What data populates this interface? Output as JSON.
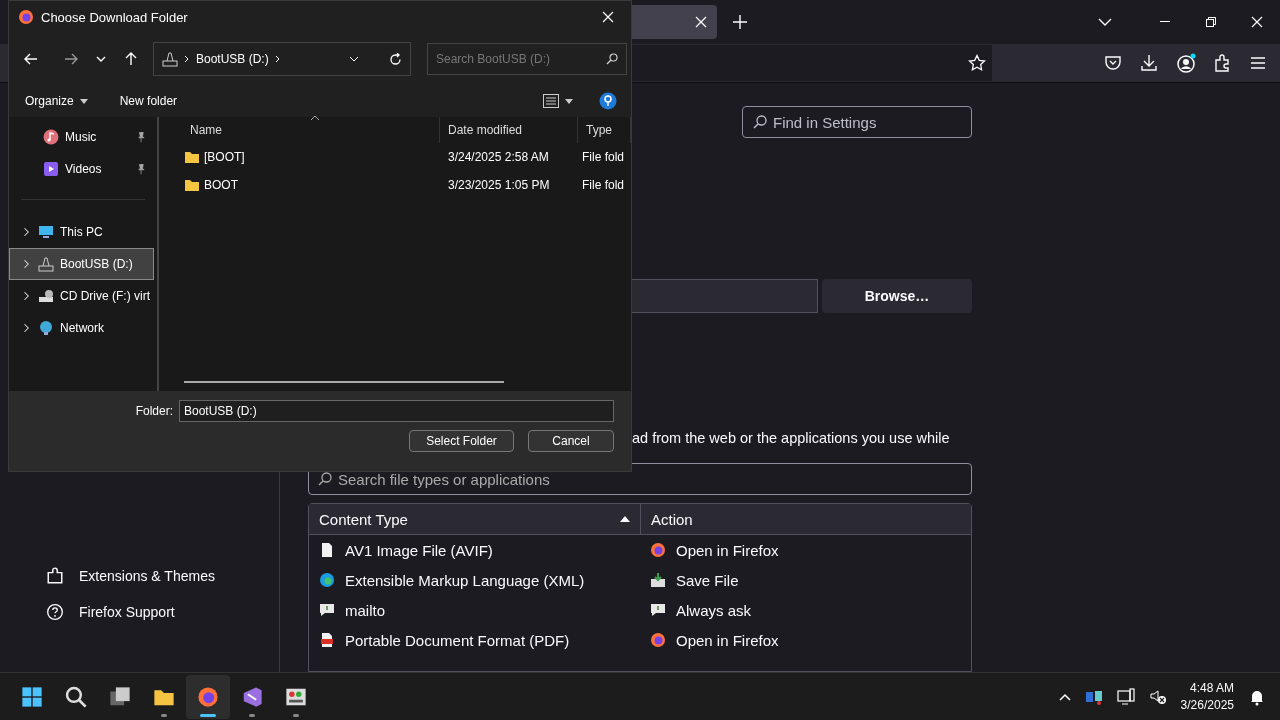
{
  "browser": {
    "find_placeholder": "Find in Settings",
    "browse_button": "Browse…",
    "description": "ad from the web or the applications you use while",
    "sidebar_links": [
      "Extensions & Themes",
      "Firefox Support"
    ],
    "search_placeholder": "Search file types or applications",
    "table": {
      "columns": [
        "Content Type",
        "Action"
      ],
      "rows": [
        {
          "type": "AV1 Image File (AVIF)",
          "action": "Open in Firefox"
        },
        {
          "type": "Extensible Markup Language (XML)",
          "action": "Save File"
        },
        {
          "type": "mailto",
          "action": "Always ask"
        },
        {
          "type": "Portable Document Format (PDF)",
          "action": "Open in Firefox"
        }
      ]
    }
  },
  "dialog": {
    "title": "Choose Download Folder",
    "address": "BootUSB (D:)",
    "search_placeholder": "Search BootUSB (D:)",
    "toolbar": [
      "Organize",
      "New folder"
    ],
    "quick_access": [
      {
        "label": "Music",
        "pinned": true
      },
      {
        "label": "Videos",
        "pinned": true
      }
    ],
    "locations": [
      {
        "label": "This PC",
        "selected": false
      },
      {
        "label": "BootUSB (D:)",
        "selected": true
      },
      {
        "label": "CD Drive (F:) virt",
        "selected": false
      },
      {
        "label": "Network",
        "selected": false
      }
    ],
    "columns": [
      "Name",
      "Date modified",
      "Type"
    ],
    "files": [
      {
        "name": "[BOOT]",
        "date": "3/24/2025 2:58 AM",
        "type": "File fold"
      },
      {
        "name": "BOOT",
        "date": "3/23/2025 1:05 PM",
        "type": "File fold"
      }
    ],
    "folder_label": "Folder:",
    "folder_value": "BootUSB (D:)",
    "buttons": [
      "Select Folder",
      "Cancel"
    ]
  },
  "taskbar": {
    "apps": [
      {
        "running": false,
        "active": false
      },
      {
        "running": false,
        "active": false
      },
      {
        "running": false,
        "active": false
      },
      {
        "running": true,
        "active": false
      },
      {
        "running": true,
        "active": true
      },
      {
        "running": true,
        "active": false
      },
      {
        "running": true,
        "active": false
      }
    ],
    "time": "4:48 AM",
    "date": "3/26/2025"
  }
}
